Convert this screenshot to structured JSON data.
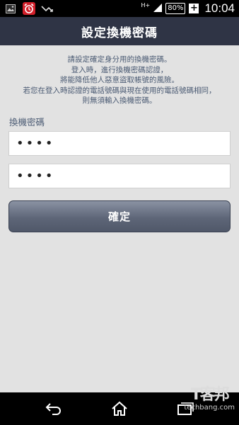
{
  "status_bar": {
    "network_type": "H+",
    "battery_percent": "80%",
    "charging_symbol": "+",
    "time": "10:04",
    "icons": [
      "image-icon",
      "alarm-icon",
      "missed-call-icon",
      "signal-icon"
    ]
  },
  "header": {
    "title": "設定換機密碼"
  },
  "instructions": {
    "lines": [
      "請設定確定身分用的換機密碼。",
      "登入時，進行換機密碼認證，",
      "將能降低他人惡意盜取帳號的風險。",
      "若您在登入時認證的電話號碼與現在使用的電話號碼相同，",
      "則無須輸入換機密碼。"
    ]
  },
  "form": {
    "label": "換機密碼",
    "password_value": "1234",
    "confirm_value": "1234"
  },
  "confirm_button": {
    "label": "確定"
  },
  "watermark": {
    "line1": "T客邦",
    "line2": "techbang.com"
  },
  "colors": {
    "header_bg": "#2f3445",
    "page_bg": "#e2e2e2",
    "instruction_text": "#4a5a73"
  }
}
